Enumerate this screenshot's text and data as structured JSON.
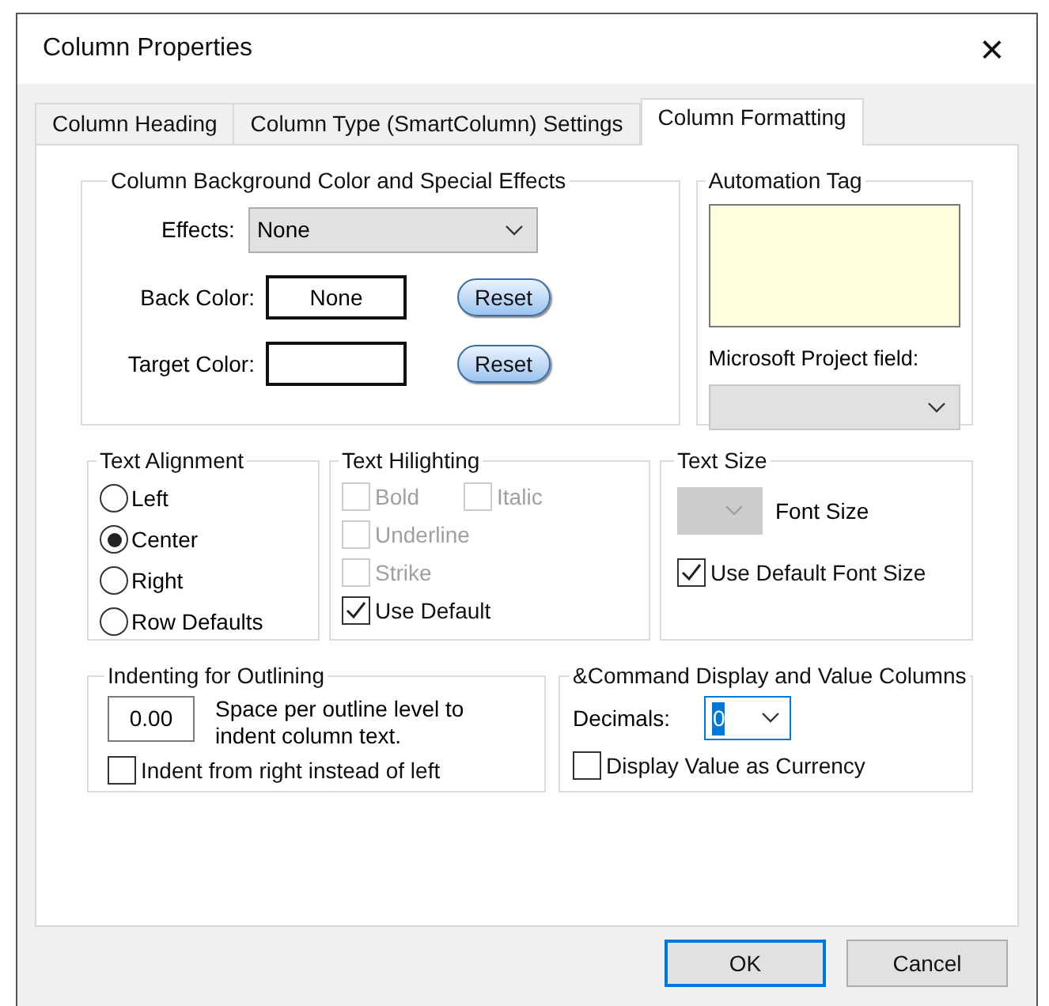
{
  "window": {
    "title": "Column Properties",
    "close": "×"
  },
  "tabs": [
    {
      "label": "Column Heading",
      "selected": false
    },
    {
      "label": "Column Type (SmartColumn) Settings",
      "selected": false
    },
    {
      "label": "Column Formatting",
      "selected": true
    }
  ],
  "background_group": {
    "title": "Column Background Color and Special Effects",
    "effects_label": "Effects:",
    "effects_value": "None",
    "back_color_label": "Back Color:",
    "back_color_value": "None",
    "target_color_label": "Target Color:",
    "reset_buttons": [
      "Reset",
      "Reset"
    ]
  },
  "automation_group": {
    "title": "Automation Tag",
    "project_field_label": "Microsoft Project field:"
  },
  "alignment_group": {
    "title": "Text Alignment",
    "options": [
      {
        "label": "Left",
        "selected": false
      },
      {
        "label": "Center",
        "selected": true
      },
      {
        "label": "Right",
        "selected": false
      },
      {
        "label": "Row Defaults",
        "selected": false
      }
    ]
  },
  "highlighting_group": {
    "title": "Text Hilighting",
    "options": [
      {
        "label": "Bold",
        "checked": false,
        "disabled": true
      },
      {
        "label": "Italic",
        "checked": false,
        "disabled": true
      },
      {
        "label": "Underline",
        "checked": false,
        "disabled": true
      },
      {
        "label": "Strike",
        "checked": false,
        "disabled": true
      },
      {
        "label": "Use Default",
        "checked": true,
        "disabled": false
      }
    ]
  },
  "size_group": {
    "title": "Text Size",
    "font_size_label": "Font Size",
    "use_default": {
      "label": "Use Default Font Size",
      "checked": true
    }
  },
  "indent_group": {
    "title": "Indenting for Outlining",
    "value": "0.00",
    "description": "Space per outline level to indent column text.",
    "from_right": {
      "label": "Indent from right instead of left",
      "checked": false
    }
  },
  "command_group": {
    "title": "&Command Display and Value Columns",
    "decimals_label": "Decimals:",
    "decimals_value": "0",
    "currency": {
      "label": "Display Value as Currency",
      "checked": false
    }
  },
  "buttons": [
    "OK",
    "Cancel"
  ]
}
